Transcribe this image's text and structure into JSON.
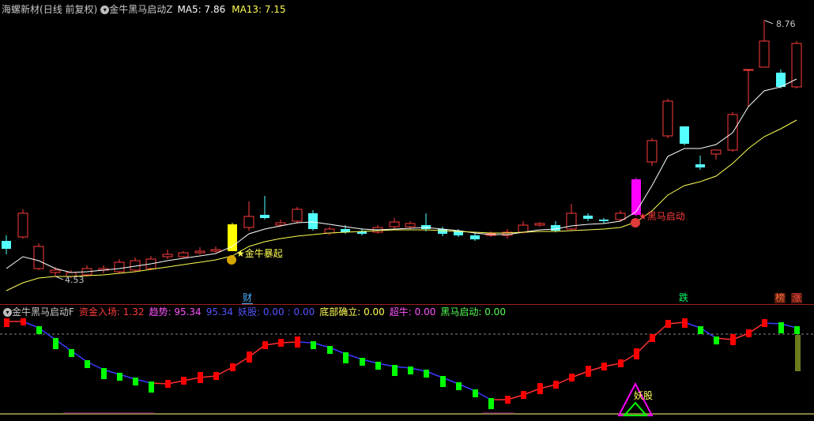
{
  "header": {
    "stock_name": "海螺新材",
    "period": "(日线 前复权)",
    "indicator_name": "金牛黑马启动Z",
    "ma5_label": "MA5: 7.86",
    "ma13_label": "MA13: 7.15"
  },
  "price_labels": {
    "high": "8.76",
    "low": "4.53",
    "signal_jinniu": "金牛暴起",
    "signal_heima": "黑马启动"
  },
  "badges": {
    "cai": "财",
    "die": "跌",
    "bang": "榜",
    "zhang": "涨"
  },
  "indicator_header": {
    "name": "金牛黑马启动F",
    "zijin": "资金入场: 1.32",
    "qushi": "趋势: 95.34",
    "qushi2": "95.34",
    "yaogu": "妖股: 0.00",
    "blank": ": 0.00",
    "dibu": "底部确立: 0.00",
    "chaoniu": "超牛: 0.00",
    "heima": "黑马启动: 0.00"
  },
  "indicator_labels": {
    "yaogu_marker": "妖股"
  },
  "colors": {
    "up": "#ff3c3c",
    "down": "#54ffff",
    "ma5": "#ffffff",
    "ma13": "#ffff54",
    "magenta": "#ff00ff",
    "yellow_bar": "#ffff00",
    "green_bar": "#00ff00",
    "red_bar": "#ff0000"
  }
}
